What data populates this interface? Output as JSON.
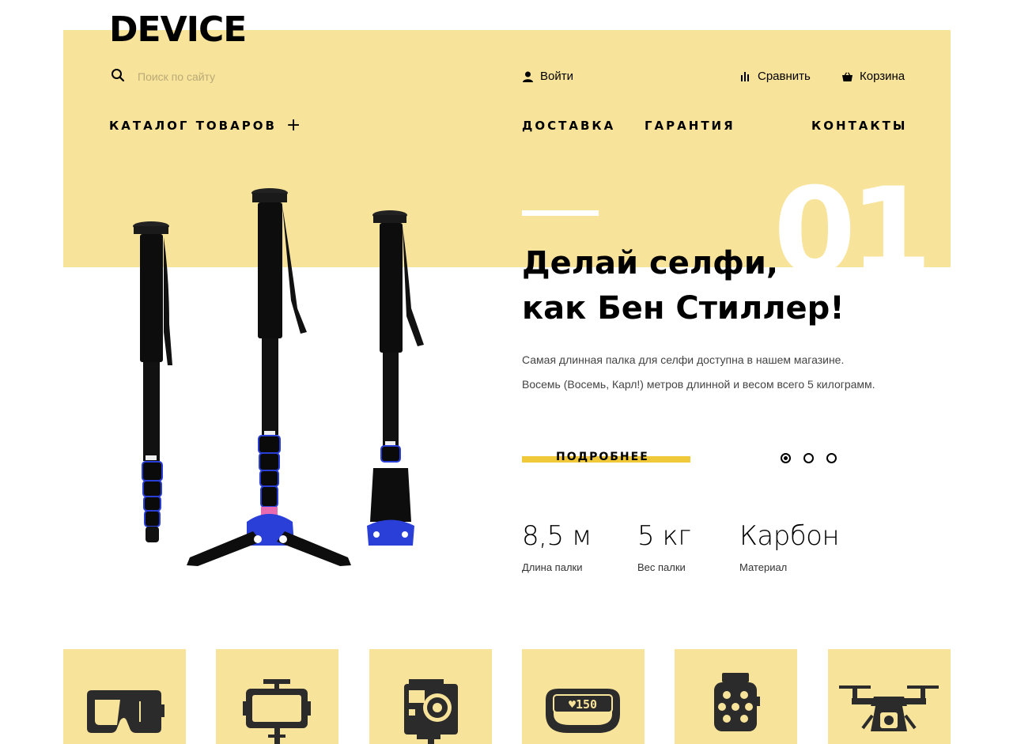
{
  "header": {
    "logo": "DEVICE",
    "search_placeholder": "Поиск по сайту",
    "login_label": "Войти",
    "compare_label": "Сравнить",
    "cart_label": "Корзина"
  },
  "nav": {
    "catalog_label": "КАТАЛОГ ТОВАРОВ",
    "catalog_plus": "+",
    "delivery_label": "ДОСТАВКА",
    "warranty_label": "ГАРАНТИЯ",
    "contacts_label": "КОНТАКТЫ"
  },
  "slider": {
    "slide_number": "01",
    "title_line1": "Делай селфи,",
    "title_line2": "как Бен Стиллер!",
    "text_line1": "Самая длинная палка для селфи доступна в нашем магазине.",
    "text_line2": "Восемь (Восемь, Карл!) метров длинной и весом всего 5 килограмм.",
    "more_label": "ПОДРОБНЕЕ",
    "dots_count": 3,
    "active_dot": 1
  },
  "specs": [
    {
      "value": "8,5 м",
      "label": "Длина палки"
    },
    {
      "value": "5 кг",
      "label": "Вес палки"
    },
    {
      "value": "Карбон",
      "label": "Материал"
    }
  ],
  "categories": [
    {
      "icon": "vr-headset-icon"
    },
    {
      "icon": "selfie-stick-icon"
    },
    {
      "icon": "action-camera-icon"
    },
    {
      "icon": "fitness-band-icon",
      "display_text": "♥150"
    },
    {
      "icon": "smartwatch-icon"
    },
    {
      "icon": "drone-icon"
    }
  ],
  "colors": {
    "hero_background": "#f8e39a",
    "accent_yellow": "#f0c93a",
    "text": "#000000",
    "white": "#ffffff"
  }
}
